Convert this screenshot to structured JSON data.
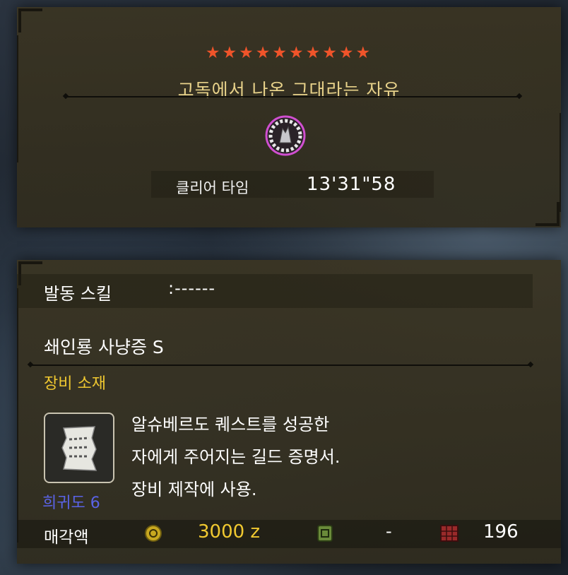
{
  "quest": {
    "stars": "★★★★★★★★★★",
    "title": "고독에서 나온 그대라는 자유",
    "clear_label": "클리어 타임",
    "clear_time": "13'31\"58"
  },
  "item": {
    "skill_label": "발동 스킬",
    "skill_value": ":------",
    "name": "쇄인룡 사냥증 S",
    "category": "장비 소재",
    "rarity": "희귀도 6",
    "description": [
      "알슈베르도 퀘스트를 성공한",
      "자에게 주어지는 길드 증명서.",
      "장비 제작에 사용."
    ],
    "sell_label": "매각액",
    "price": "3000 z",
    "points": "-",
    "box_count": "196",
    "icons": {
      "monster": "monster-crest-icon",
      "item": "scroll-certificate-icon",
      "coin": "zenny-coin-icon",
      "points": "research-points-icon",
      "box": "item-box-icon"
    }
  },
  "colors": {
    "star": "#f0542a",
    "title": "#e8d28a",
    "category": "#f0c830",
    "rarity": "#5a63e6"
  }
}
